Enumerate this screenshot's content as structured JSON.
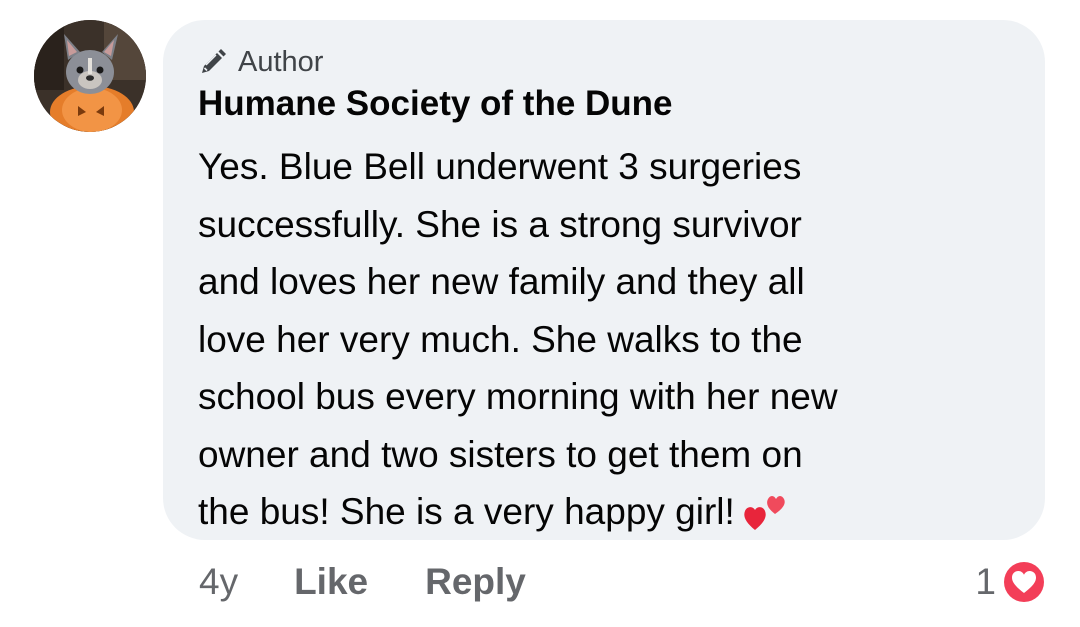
{
  "comment": {
    "avatar_icon": "french-bulldog-in-pumpkin-avatar",
    "badge": {
      "icon": "pencil-icon",
      "label": "Author"
    },
    "author": "Humane Society of the Dune",
    "lines": [
      "Yes. Blue Bell underwent 3 surgeries",
      "successfully. She is a strong survivor",
      "and loves her new family and they all",
      "love her very much. She walks to the",
      "school bus every morning with her new",
      "owner and two sisters to get them on",
      "the bus! She is a very happy girl!"
    ],
    "trailing_emoji": "two-hearts-emoji"
  },
  "actions": {
    "time": "4y",
    "like_label": "Like",
    "reply_label": "Reply"
  },
  "reactions": {
    "count": "1",
    "icon": "love-reaction-icon"
  },
  "colors": {
    "bubble_bg": "#eff2f5",
    "secondary_text": "#65676b",
    "love_red": "#f33e58"
  }
}
